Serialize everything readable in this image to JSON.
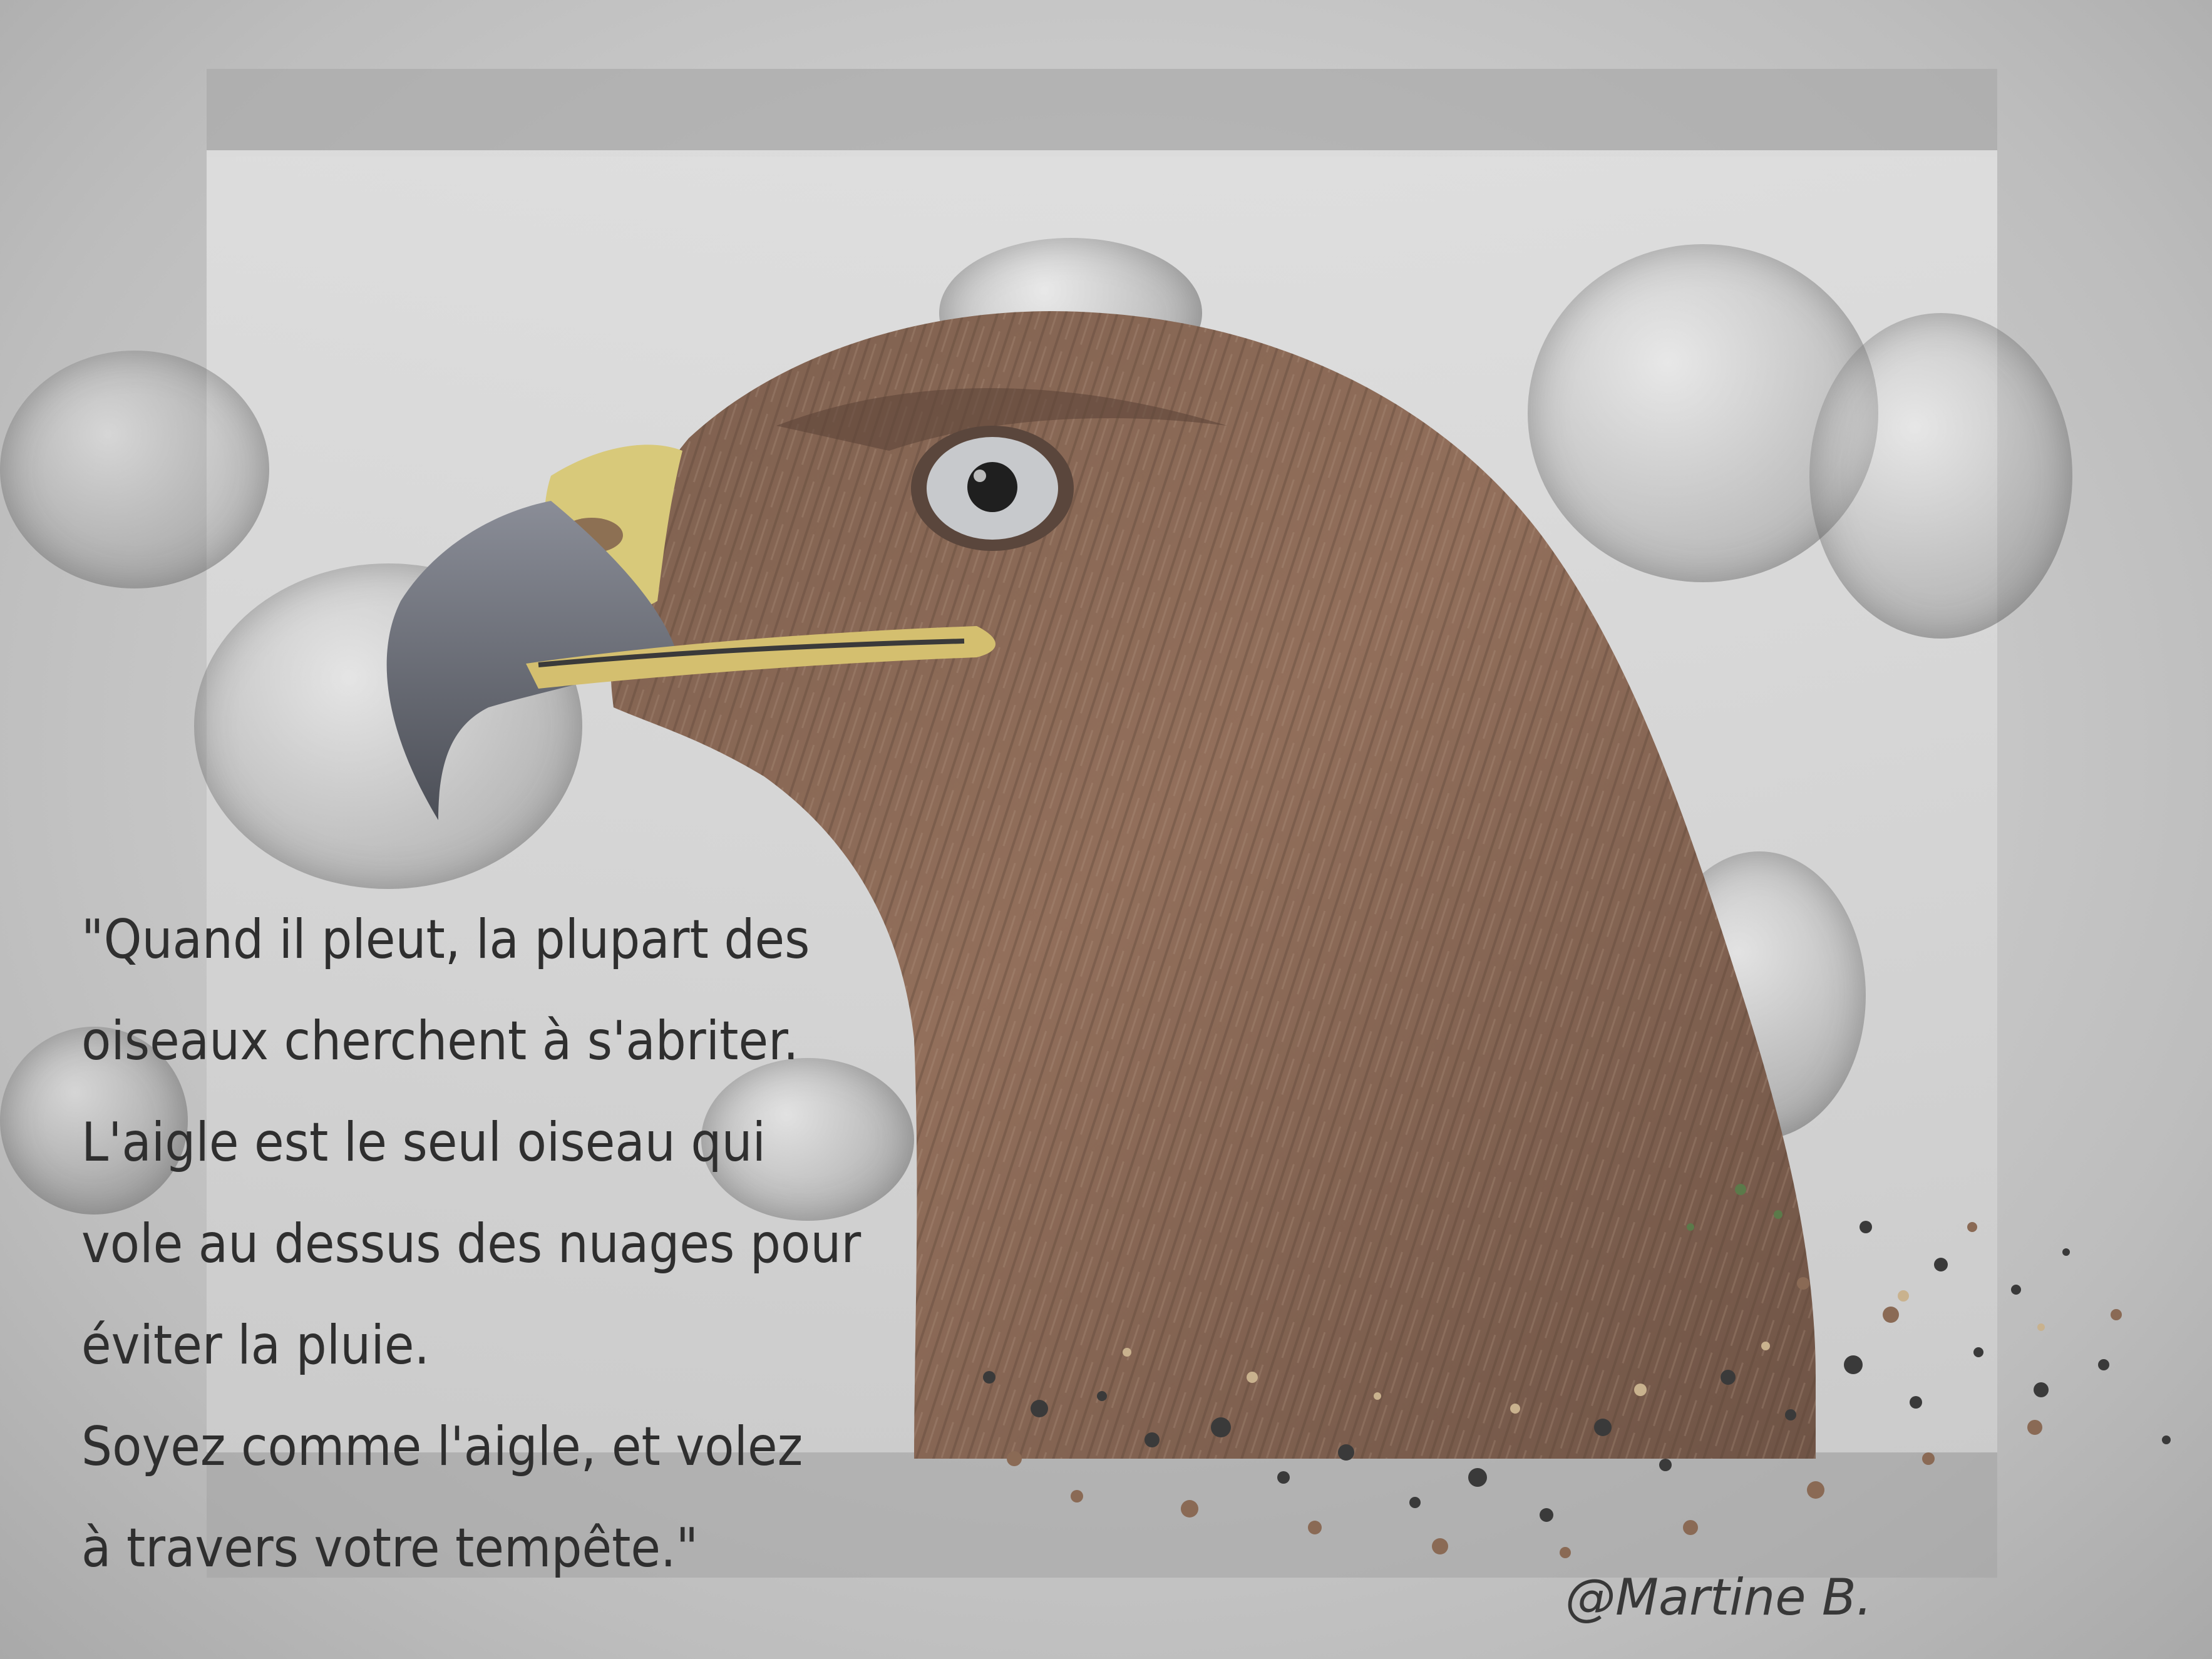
{
  "quote": {
    "lines": [
      "\"Quand il pleut, la plupart des",
      "oiseaux cherchent à s'abriter.",
      "L'aigle est le seul oiseau qui",
      "vole au dessus des nuages pour",
      "éviter la pluie.",
      "Soyez comme l'aigle, et volez",
      "à travers votre tempête.\""
    ]
  },
  "signature": "@Martine B.",
  "colors": {
    "background": "#b4b4b4",
    "eagle_feathers": "#8a6a55",
    "beak": "#6c6f78",
    "cere": "#d8c97a",
    "text": "#2f2f2f"
  },
  "image": {
    "subject": "eagle-head-profile",
    "style": "grayscale-textured-background-with-bubbles"
  }
}
